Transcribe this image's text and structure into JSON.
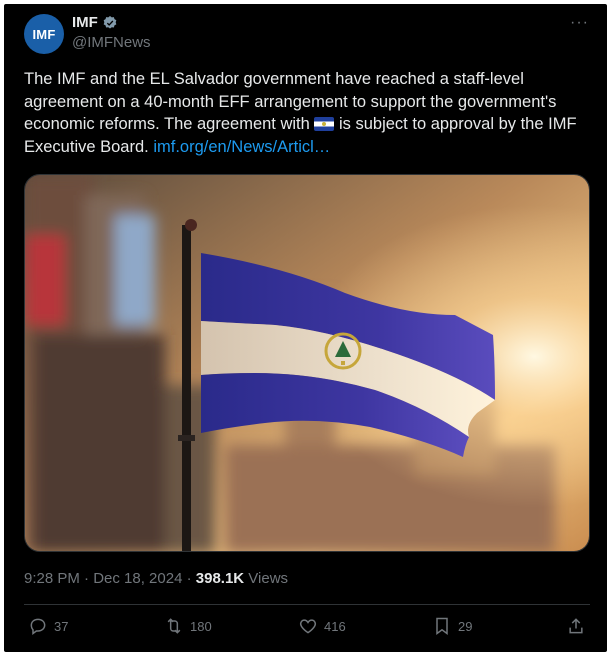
{
  "tweet": {
    "avatar_text": "IMF",
    "name": "IMF",
    "handle": "@IMFNews",
    "text_before_flag": "The IMF and the EL Salvador government have reached a staff-level agreement on a 40-month EFF arrangement to support the government's economic reforms. The agreement with ",
    "text_after_flag": " is subject to approval by the IMF Executive Board. ",
    "link": "imf.org/en/News/Articl…",
    "flag_emoji_label": "El Salvador flag",
    "time": "9:28 PM · Dec 18, 2024 · ",
    "views_count": "398.1K",
    "views_label": " Views"
  },
  "actions": {
    "replies": "37",
    "retweets": "180",
    "likes": "416",
    "bookmarks": "29"
  },
  "icons": [
    "verified-badge-icon",
    "more-icon",
    "reply-icon",
    "retweet-icon",
    "like-icon",
    "bookmark-icon",
    "share-icon"
  ],
  "colors": {
    "accent": "#1d9bf0",
    "background": "#000000",
    "text": "#e7e9ea",
    "muted": "#71767b"
  }
}
